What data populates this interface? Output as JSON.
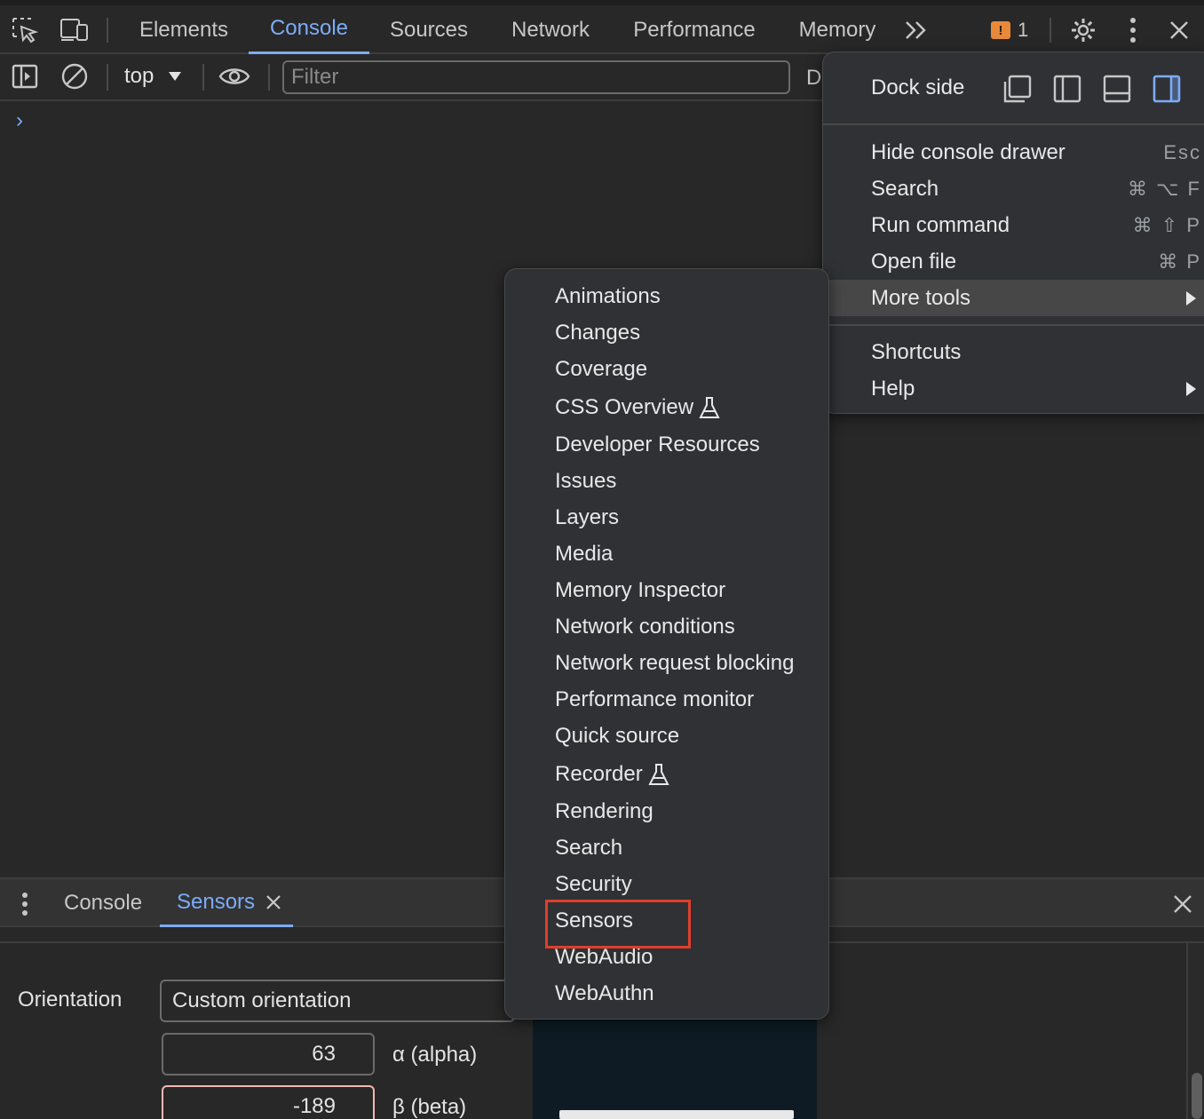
{
  "tabs": [
    "Elements",
    "Console",
    "Sources",
    "Network",
    "Performance",
    "Memory"
  ],
  "active_tab": "Console",
  "issues_count": "1",
  "console_toolbar": {
    "context": "top",
    "filter_placeholder": "Filter",
    "cutoff_text": "D"
  },
  "prompt_glyph": "›",
  "main_menu": {
    "dock_side_label": "Dock side",
    "items": [
      {
        "label": "Hide console drawer",
        "shortcut": "Esc"
      },
      {
        "label": "Search",
        "shortcut": "⌘ ⌥ F"
      },
      {
        "label": "Run command",
        "shortcut": "⌘ ⇧ P"
      },
      {
        "label": "Open file",
        "shortcut": "⌘ P"
      },
      {
        "label": "More tools",
        "shortcut": ""
      },
      {
        "label": "Shortcuts",
        "shortcut": ""
      },
      {
        "label": "Help",
        "shortcut": ""
      }
    ]
  },
  "more_tools": [
    "Animations",
    "Changes",
    "Coverage",
    "CSS Overview",
    "Developer Resources",
    "Issues",
    "Layers",
    "Media",
    "Memory Inspector",
    "Network conditions",
    "Network request blocking",
    "Performance monitor",
    "Quick source",
    "Recorder",
    "Rendering",
    "Search",
    "Security",
    "Sensors",
    "WebAudio",
    "WebAuthn"
  ],
  "drawer": {
    "tabs": [
      "Console",
      "Sensors"
    ],
    "active": "Sensors"
  },
  "sensors": {
    "orientation_label": "Orientation",
    "orientation_value": "Custom orientation",
    "alpha_value": "63",
    "alpha_label": "α (alpha)",
    "beta_value": "-189",
    "beta_label": "β (beta)"
  },
  "colors": {
    "accent": "#7cacf8",
    "highlight_box": "#e03e2d",
    "warning": "#e8893a"
  }
}
